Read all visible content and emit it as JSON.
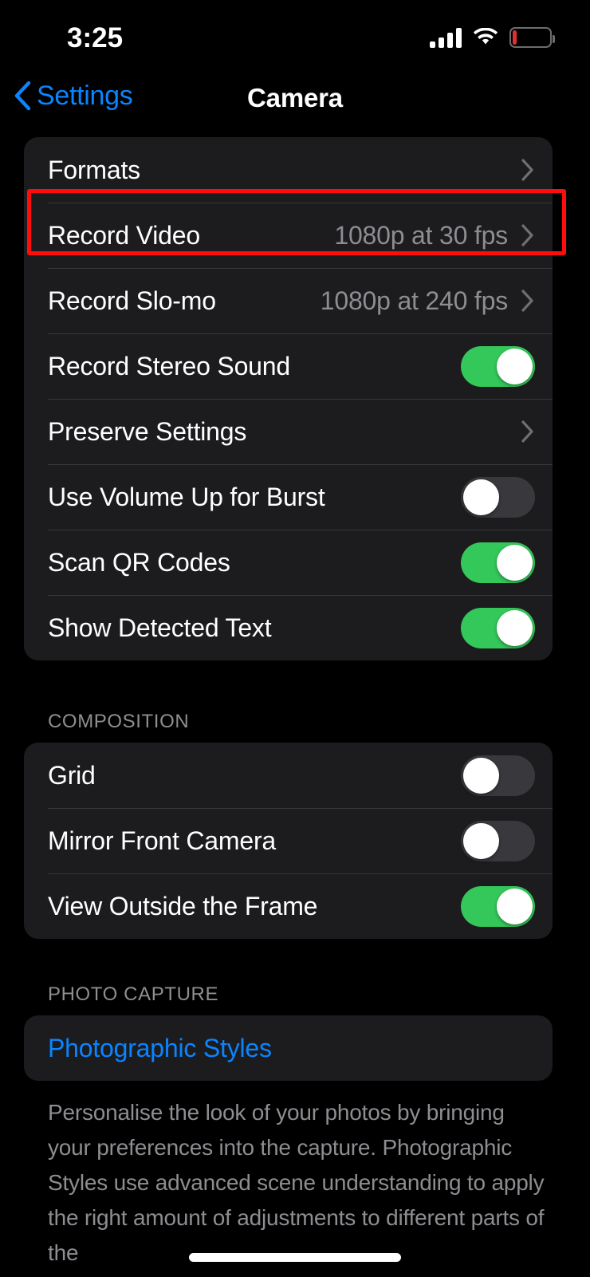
{
  "status_bar": {
    "time": "3:25",
    "cellular_icon": "cellular-bars-icon",
    "wifi_icon": "wifi-icon",
    "battery_icon": "battery-low-icon",
    "battery_level_percent": 8
  },
  "nav": {
    "back_label": "Settings",
    "back_icon": "chevron-left-icon",
    "title": "Camera"
  },
  "sections": [
    {
      "header": "",
      "rows": [
        {
          "label": "Formats",
          "type": "disclosure",
          "value": "",
          "highlighted": true
        },
        {
          "label": "Record Video",
          "type": "disclosure",
          "value": "1080p at 30 fps",
          "highlighted": false
        },
        {
          "label": "Record Slo-mo",
          "type": "disclosure",
          "value": "1080p at 240 fps",
          "highlighted": false
        },
        {
          "label": "Record Stereo Sound",
          "type": "toggle",
          "toggle_state": "on",
          "highlighted": false
        },
        {
          "label": "Preserve Settings",
          "type": "disclosure",
          "value": "",
          "highlighted": false
        },
        {
          "label": "Use Volume Up for Burst",
          "type": "toggle",
          "toggle_state": "off",
          "highlighted": false
        },
        {
          "label": "Scan QR Codes",
          "type": "toggle",
          "toggle_state": "on",
          "highlighted": false
        },
        {
          "label": "Show Detected Text",
          "type": "toggle",
          "toggle_state": "on",
          "highlighted": false
        }
      ]
    },
    {
      "header": "COMPOSITION",
      "rows": [
        {
          "label": "Grid",
          "type": "toggle",
          "toggle_state": "off",
          "highlighted": false
        },
        {
          "label": "Mirror Front Camera",
          "type": "toggle",
          "toggle_state": "off",
          "highlighted": false
        },
        {
          "label": "View Outside the Frame",
          "type": "toggle",
          "toggle_state": "on",
          "highlighted": false
        }
      ]
    },
    {
      "header": "PHOTO CAPTURE",
      "rows": [
        {
          "label": "Photographic Styles",
          "type": "link",
          "value": "",
          "highlighted": false
        }
      ],
      "footer": "Personalise the look of your photos by bringing your preferences into the capture. Photographic Styles use advanced scene understanding to apply the right amount of adjustments to different parts of the"
    }
  ],
  "colors": {
    "accent_blue": "#0A84FF",
    "toggle_on_green": "#34C759",
    "toggle_off_gray": "#39393D",
    "card_background": "#1C1C1E",
    "page_background": "#000000",
    "secondary_text": "#8E8E93",
    "highlight_red": "#FF0D0D",
    "battery_low_red": "#E03131"
  },
  "home_indicator": "home-indicator"
}
